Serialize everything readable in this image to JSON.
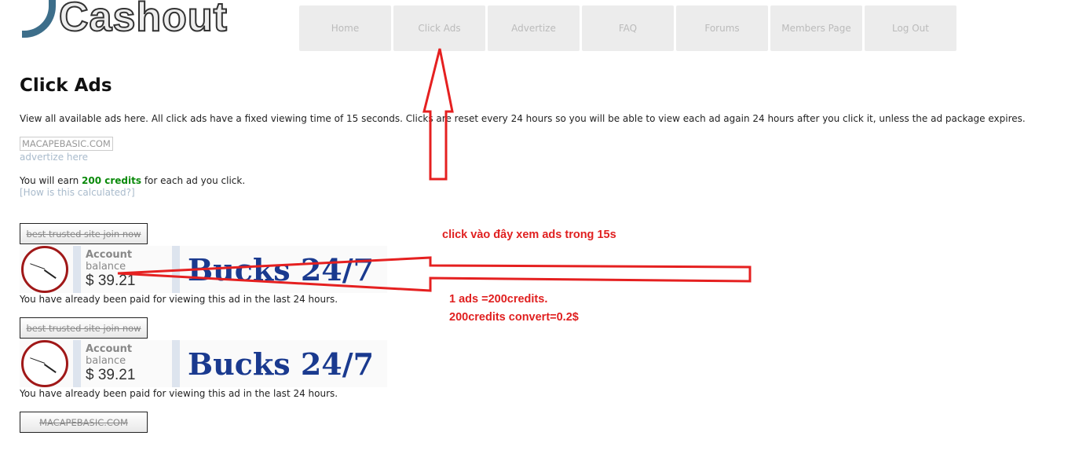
{
  "logo": "Cashout",
  "nav": [
    "Home",
    "Click Ads",
    "Advertize",
    "FAQ",
    "Forums",
    "Members Page",
    "Log Out"
  ],
  "page_title": "Click Ads",
  "intro": "View all available ads here. All click ads have a fixed viewing time of 15 seconds. Clicks are reset every 24 hours so you will be able to view each ad again 24 hours after you click it, unless the ad package expires.",
  "banner_alt": "MACAPEBASIC.COM",
  "advertize_link": "advertize here",
  "earn": {
    "prefix": "You will earn ",
    "credits": "200 credits",
    "suffix": " for each ad you click.",
    "how": "[How is this calculated?]"
  },
  "ads": [
    {
      "title": "best trusted site join now",
      "balance_label_a": "Account",
      "balance_label_b": " balance",
      "balance": "$ 39.21",
      "brand": "Bucks 24/7",
      "status": "You have already been paid for viewing this ad in the last 24 hours."
    },
    {
      "title": "best trusted site join now",
      "balance_label_a": "Account",
      "balance_label_b": " balance",
      "balance": "$ 39.21",
      "brand": "Bucks 24/7",
      "status": "You have already been paid for viewing this ad in the last 24 hours."
    },
    {
      "title": "MACAPEBASIC.COM"
    }
  ],
  "annotations": {
    "click_here": "click vào đây xem ads trong 15s",
    "line1": "1 ads =200credits.",
    "line2": "200credits convert=0.2$"
  },
  "colors": {
    "annotation": "#e02020",
    "credits": "#0a8a0a"
  }
}
